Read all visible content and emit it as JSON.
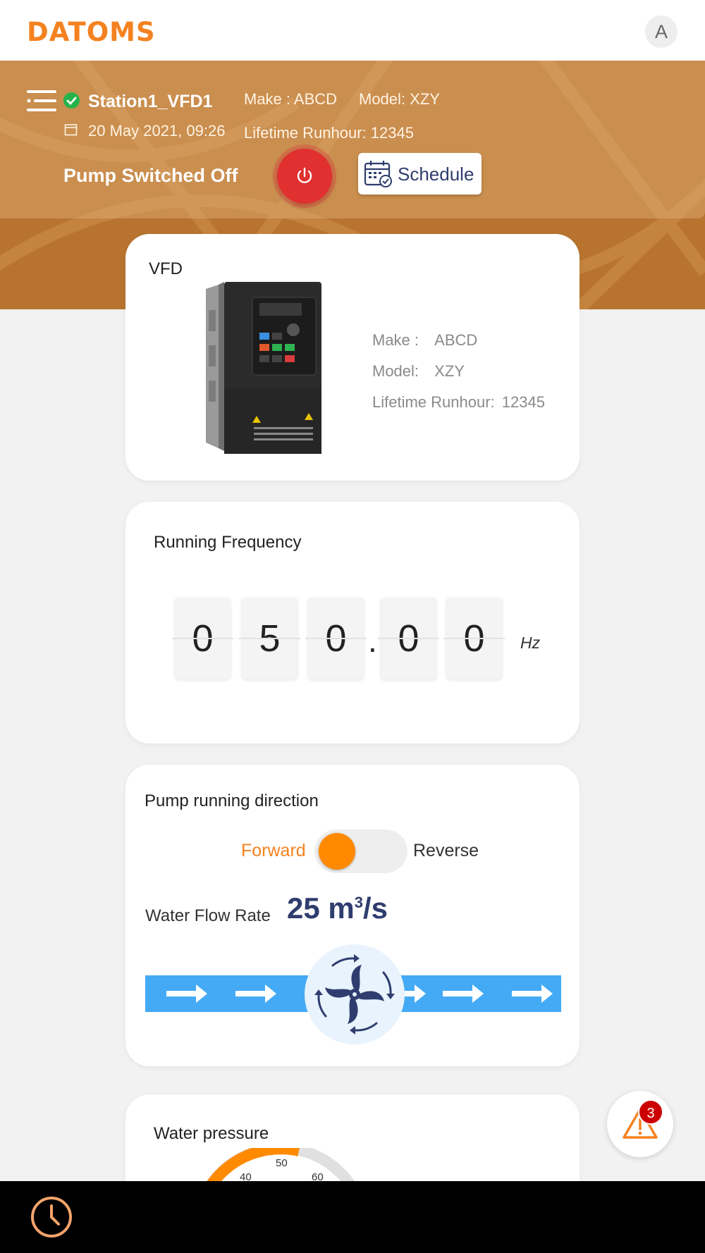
{
  "app": {
    "logo": "DATOMS",
    "avatar_initial": "A"
  },
  "header": {
    "station_name": "Station1_VFD1",
    "make": "Make : ABCD",
    "model": "Model: XZY",
    "datetime": "20 May 2021, 09:26",
    "lifetime": "Lifetime Runhour: 12345",
    "pump_status": "Pump Switched Off",
    "schedule_label": "Schedule",
    "power_color": "#e0302f"
  },
  "vfd_card": {
    "title": "VFD",
    "make_label": "Make :",
    "make_value": "ABCD",
    "model_label": "Model:",
    "model_value": "XZY",
    "runhour_label": "Lifetime Runhour:",
    "runhour_value": "12345"
  },
  "frequency": {
    "title": "Running Frequency",
    "digits": [
      "0",
      "5",
      "0",
      "0",
      "0"
    ],
    "decimal": ".",
    "unit": "Hz"
  },
  "direction": {
    "title": "Pump running direction",
    "forward": "Forward",
    "reverse": "Reverse",
    "selected": "Forward",
    "flow_label": "Water Flow Rate",
    "flow_value": "25 m",
    "flow_exp": "3",
    "flow_unit": "/s"
  },
  "pressure": {
    "title": "Water pressure",
    "gauge_ticks": [
      "40",
      "50",
      "60"
    ]
  },
  "alerts": {
    "count": "3"
  },
  "colors": {
    "accent": "#f58220",
    "navy": "#2f3d6e",
    "pipe": "#44aaf5",
    "success": "#27b34a"
  }
}
